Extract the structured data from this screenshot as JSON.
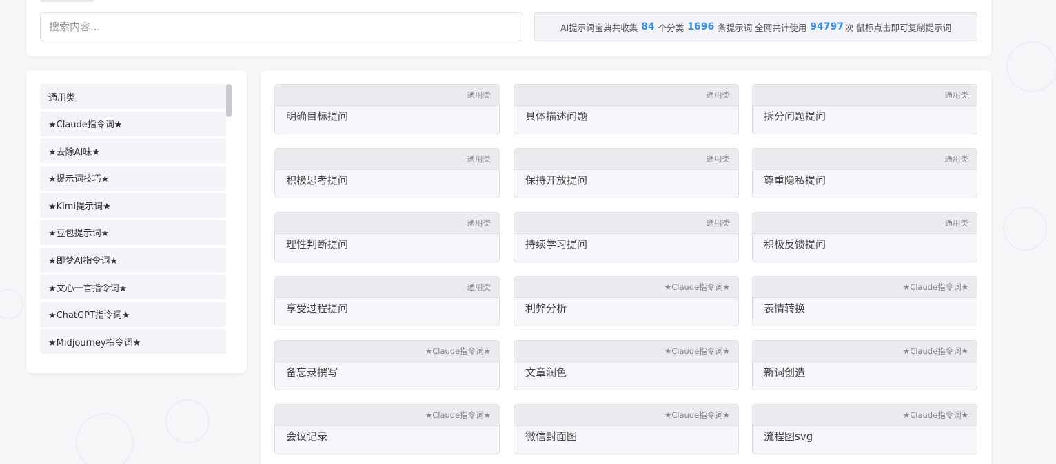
{
  "search": {
    "placeholder": "搜索内容..."
  },
  "stats": {
    "prefix": "AI提示词宝典共收集",
    "categories_count": "84",
    "categories_unit": "个分类",
    "prompts_count": "1696",
    "prompts_unit": "条提示词 全网共计使用",
    "usage_count": "94797",
    "usage_suffix": "次 鼠标点击即可复制提示词"
  },
  "sidebar": {
    "items": [
      "通用类",
      "★Claude指令词★",
      "★去除AI味★",
      "★提示词技巧★",
      "★Kimi提示词★",
      "★豆包提示词★",
      "★即梦AI指令词★",
      "★文心一言指令词★",
      "★ChatGPT指令词★",
      "★Midjourney指令词★"
    ]
  },
  "cards": [
    {
      "tag": "通用类",
      "title": "明确目标提问"
    },
    {
      "tag": "通用类",
      "title": "具体描述问题"
    },
    {
      "tag": "通用类",
      "title": "拆分问题提问"
    },
    {
      "tag": "通用类",
      "title": "积极思考提问"
    },
    {
      "tag": "通用类",
      "title": "保持开放提问"
    },
    {
      "tag": "通用类",
      "title": "尊重隐私提问"
    },
    {
      "tag": "通用类",
      "title": "理性判断提问"
    },
    {
      "tag": "通用类",
      "title": "持续学习提问"
    },
    {
      "tag": "通用类",
      "title": "积极反馈提问"
    },
    {
      "tag": "通用类",
      "title": "享受过程提问"
    },
    {
      "tag": "★Claude指令词★",
      "title": "利弊分析"
    },
    {
      "tag": "★Claude指令词★",
      "title": "表情转换"
    },
    {
      "tag": "★Claude指令词★",
      "title": "备忘录撰写"
    },
    {
      "tag": "★Claude指令词★",
      "title": "文章润色"
    },
    {
      "tag": "★Claude指令词★",
      "title": "新词创造"
    },
    {
      "tag": "★Claude指令词★",
      "title": "会议记录"
    },
    {
      "tag": "★Claude指令词★",
      "title": "微信封面图"
    },
    {
      "tag": "★Claude指令词★",
      "title": "流程图svg"
    }
  ]
}
